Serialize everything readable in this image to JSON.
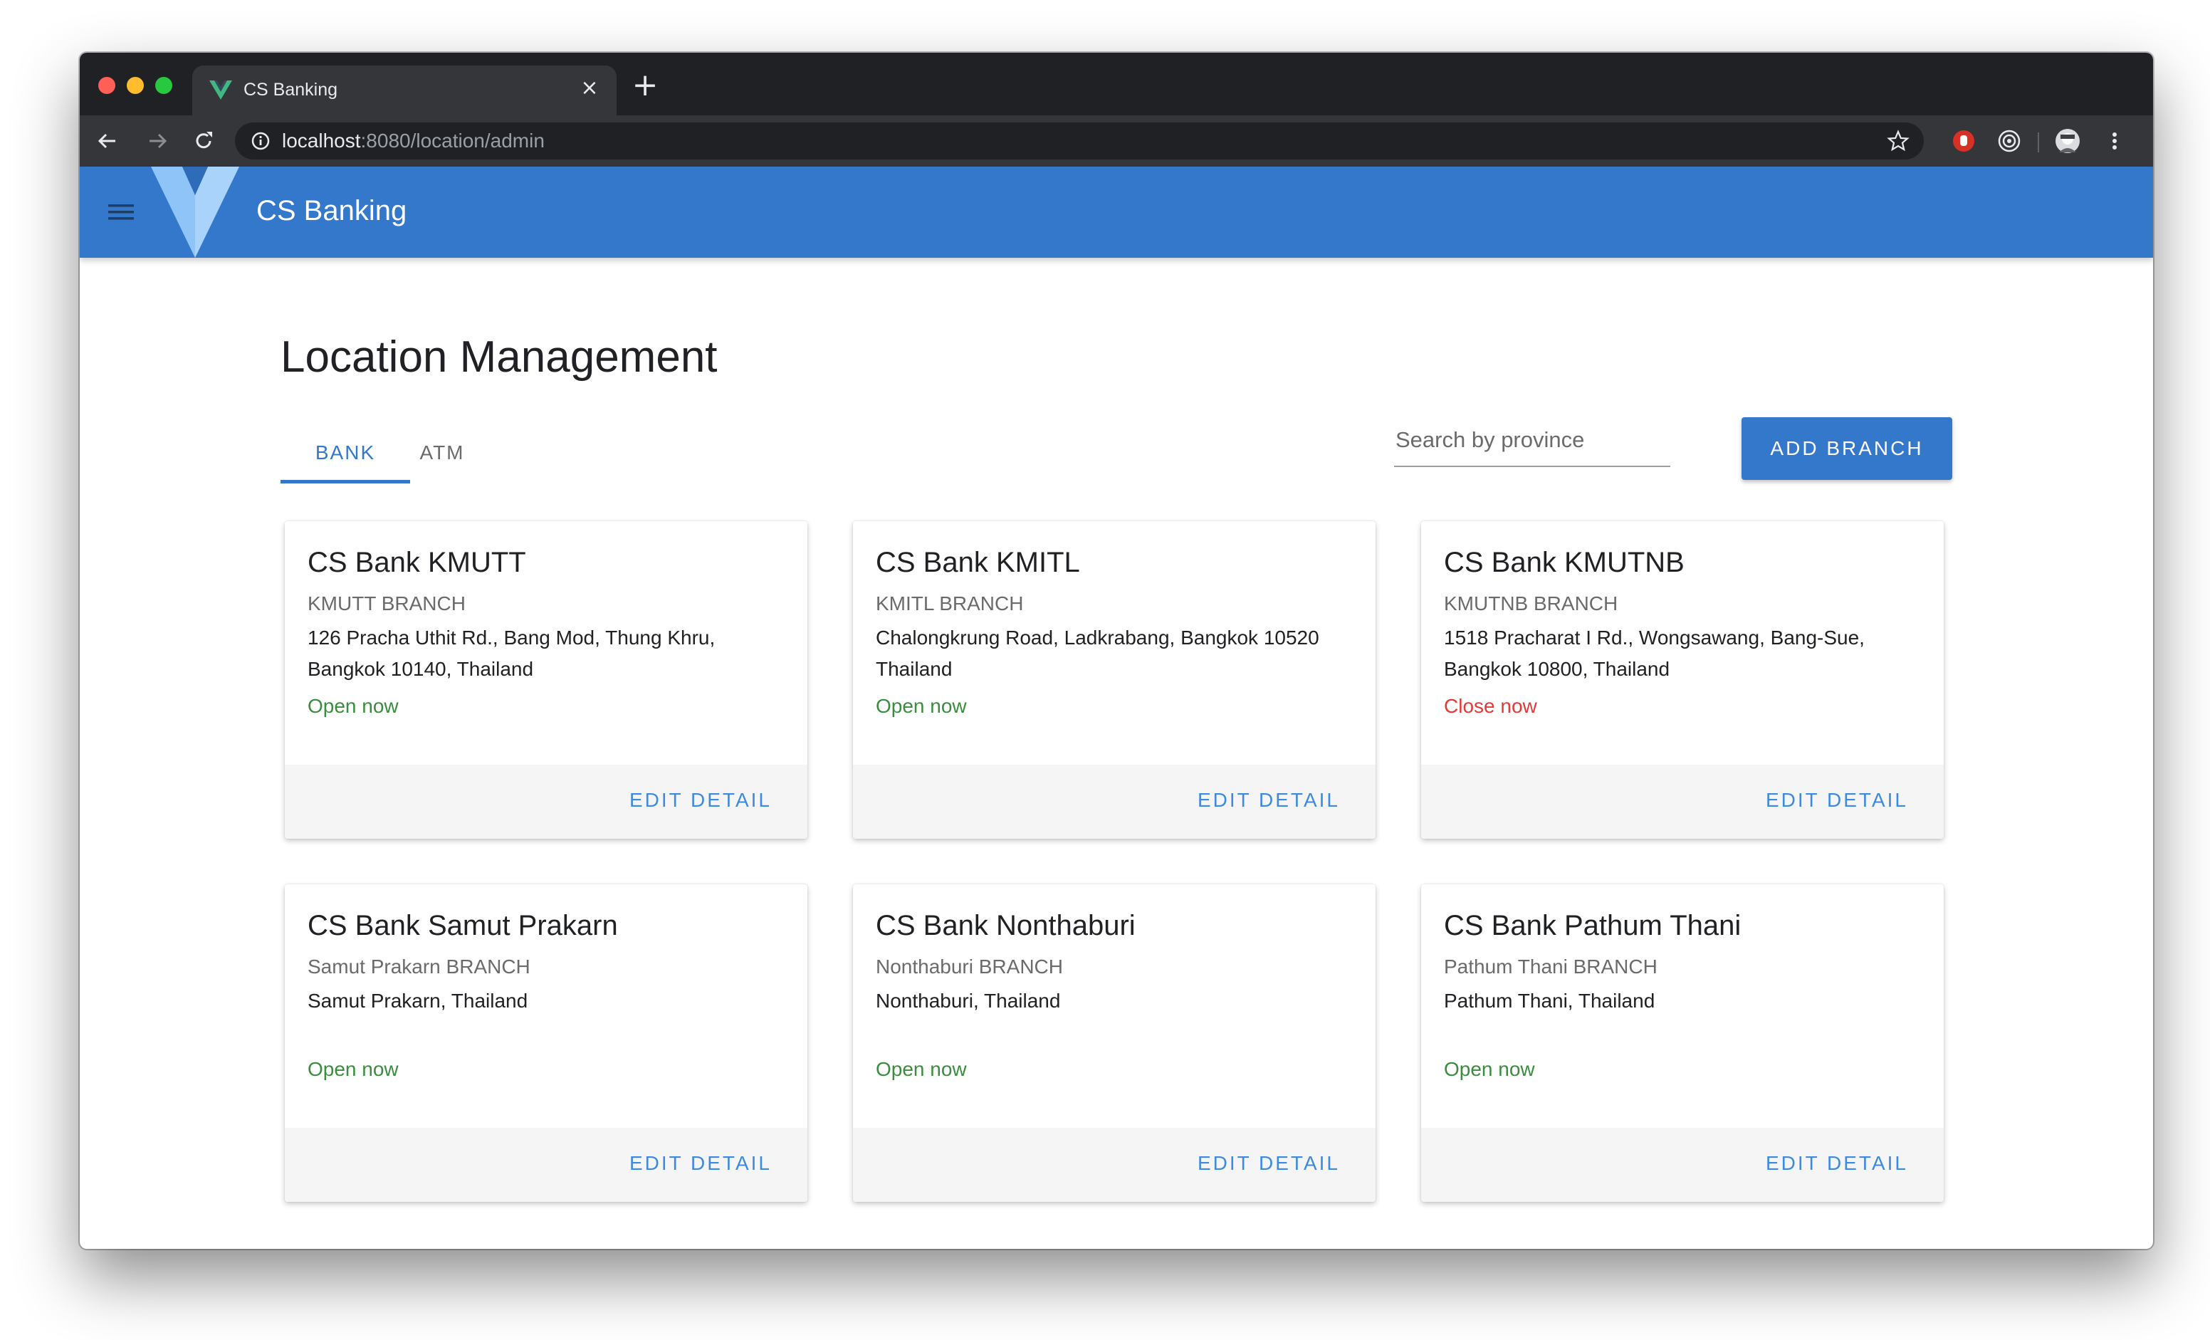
{
  "browser": {
    "tab_title": "CS Banking",
    "tab_close": "×",
    "new_tab": "+",
    "url_host": "localhost",
    "url_path": ":8080/location/admin"
  },
  "app": {
    "title": "CS Banking",
    "brand_color": "#3478cc"
  },
  "page": {
    "title": "Location Management",
    "tabs": [
      {
        "label": "BANK",
        "active": true
      },
      {
        "label": "ATM",
        "active": false
      }
    ],
    "search_placeholder": "Search by province",
    "add_button_label": "ADD BRANCH"
  },
  "branches": [
    {
      "name": "CS Bank KMUTT",
      "branch": "KMUTT BRANCH",
      "address_line1": "126 Pracha Uthit Rd., Bang Mod, Thung Khru,",
      "address_line2": "Bangkok 10140, Thailand",
      "status": "Open now",
      "status_color": "#388e3c",
      "action": "EDIT DETAIL"
    },
    {
      "name": "CS Bank KMITL",
      "branch": "KMITL BRANCH",
      "address_line1": "Chalongkrung Road, Ladkrabang, Bangkok 10520",
      "address_line2": "Thailand",
      "status": "Open now",
      "status_color": "#388e3c",
      "action": "EDIT DETAIL"
    },
    {
      "name": "CS Bank KMUTNB",
      "branch": "KMUTNB BRANCH",
      "address_line1": "1518 Pracharat I Rd., Wongsawang, Bang-Sue,",
      "address_line2": "Bangkok 10800, Thailand",
      "status": "Close now",
      "status_color": "#e53935",
      "action": "EDIT DETAIL"
    },
    {
      "name": "CS Bank Samut Prakarn",
      "branch": "Samut Prakarn BRANCH",
      "address_line1": "Samut Prakarn, Thailand",
      "address_line2": "",
      "status": "Open now",
      "status_color": "#388e3c",
      "action": "EDIT DETAIL"
    },
    {
      "name": "CS Bank Nonthaburi",
      "branch": "Nonthaburi BRANCH",
      "address_line1": "Nonthaburi, Thailand",
      "address_line2": "",
      "status": "Open now",
      "status_color": "#388e3c",
      "action": "EDIT DETAIL"
    },
    {
      "name": "CS Bank Pathum Thani",
      "branch": "Pathum Thani BRANCH",
      "address_line1": "Pathum Thani, Thailand",
      "address_line2": "",
      "status": "Open now",
      "status_color": "#388e3c",
      "action": "EDIT DETAIL"
    }
  ]
}
